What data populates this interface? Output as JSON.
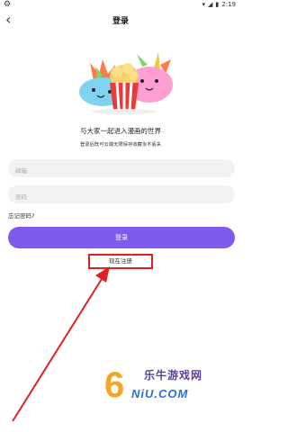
{
  "status_bar": {
    "time": "2:19"
  },
  "header": {
    "title": "登录"
  },
  "login": {
    "tagline": "与大家一起进入漫画的世界",
    "subtext": "登录后既可云端无限保存收藏永不丢失",
    "email_placeholder": "邮箱",
    "password_placeholder": "密码",
    "forgot_label": "忘记密码?",
    "login_label": "登录",
    "register_label": "现在注册"
  },
  "colors": {
    "accent": "#7e5bef",
    "highlight": "#e02020"
  },
  "watermark": {
    "text": "乐牛游戏网",
    "number": "6",
    "domain": "NiU.COM"
  }
}
